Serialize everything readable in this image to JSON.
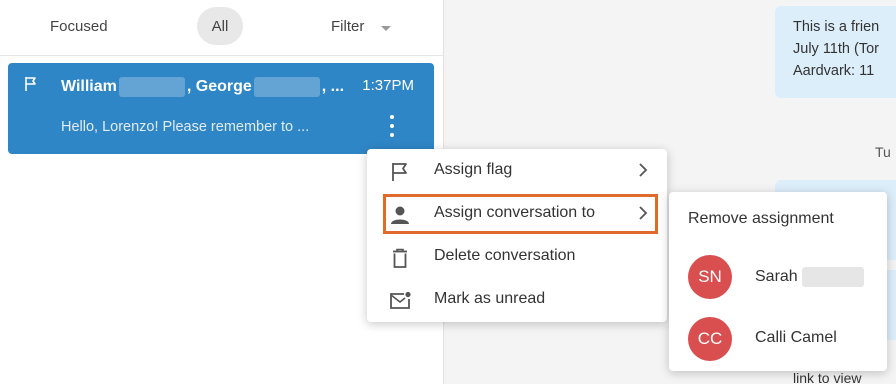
{
  "inbox": {
    "tabs": {
      "focused": "Focused",
      "all": "All"
    },
    "filter_label": "Filter"
  },
  "conversation": {
    "name_1": "William",
    "name_2": ", George",
    "names_suffix": ", ...",
    "time": "1:37PM",
    "preview": "Hello, Lorenzo! Please remember to ..."
  },
  "thread": {
    "message_lines": [
      "This is a frien",
      "July 11th (Tor",
      "Aardvark: 11"
    ],
    "date_separator": "Tu",
    "bottom_text": "link to view"
  },
  "context_menu": {
    "items": [
      {
        "label": "Assign flag",
        "icon": "flag-icon"
      },
      {
        "label": "Assign conversation to",
        "icon": "person-icon"
      },
      {
        "label": "Delete conversation",
        "icon": "trash-icon"
      },
      {
        "label": "Mark as unread",
        "icon": "mail-unread-icon"
      }
    ],
    "highlight_color": "#e06a2c"
  },
  "assign_submenu": {
    "remove_label": "Remove assignment",
    "users": [
      {
        "initials": "SN",
        "name": "Sarah"
      },
      {
        "initials": "CC",
        "name": "Calli Camel"
      }
    ],
    "avatar_color": "#d94f4f"
  },
  "colors": {
    "selected_row": "#2f86c6",
    "message_bubble": "#dceefa"
  }
}
